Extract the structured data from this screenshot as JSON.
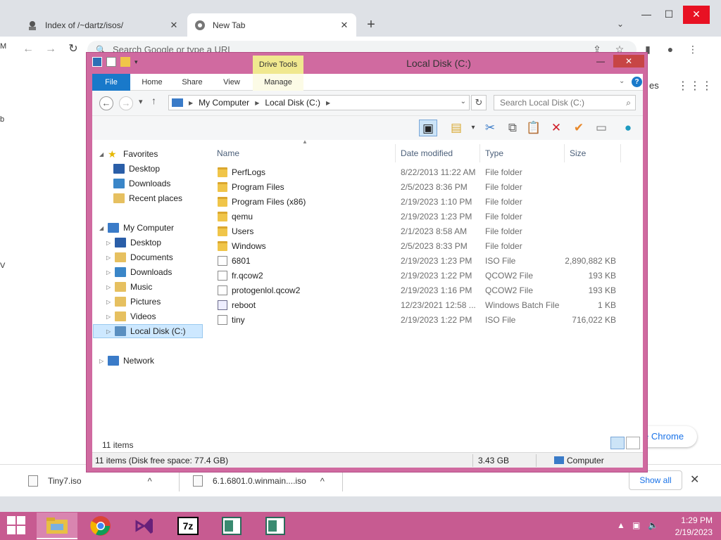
{
  "browser": {
    "tabs": [
      {
        "title": "Index of /~dartz/isos/",
        "close": "✕"
      },
      {
        "title": "New Tab",
        "close": "✕"
      }
    ],
    "new_tab": "+",
    "tab_search": "⌄",
    "window_controls": {
      "min": "—",
      "max": "☐",
      "close": "✕"
    },
    "omnibox_placeholder": "Search Google or type a URL",
    "page_fragment_right": "es",
    "chrome_button": "e Chrome",
    "left_fragments": [
      "M",
      "b",
      "V"
    ]
  },
  "downloads": {
    "items": [
      {
        "name": "Tiny7.iso"
      },
      {
        "name": "6.1.6801.0.winmain....iso"
      }
    ],
    "show_all": "Show all",
    "close": "✕"
  },
  "explorer": {
    "title": "Local Disk (C:)",
    "contextual_tab": "Drive Tools",
    "ribbon_tabs": [
      "File",
      "Home",
      "Share",
      "View",
      "Manage"
    ],
    "address_path": [
      "My Computer",
      "Local Disk (C:)"
    ],
    "search_placeholder": "Search Local Disk (C:)",
    "nav": {
      "favorites": "Favorites",
      "favorites_items": [
        "Desktop",
        "Downloads",
        "Recent places"
      ],
      "computer": "My Computer",
      "computer_items": [
        "Desktop",
        "Documents",
        "Downloads",
        "Music",
        "Pictures",
        "Videos",
        "Local Disk (C:)"
      ],
      "network": "Network"
    },
    "columns": [
      "Name",
      "Date modified",
      "Type",
      "Size"
    ],
    "files": [
      {
        "name": "PerfLogs",
        "date": "8/22/2013 11:22 AM",
        "type": "File folder",
        "size": "",
        "icon": "folder"
      },
      {
        "name": "Program Files",
        "date": "2/5/2023 8:36 PM",
        "type": "File folder",
        "size": "",
        "icon": "folder"
      },
      {
        "name": "Program Files (x86)",
        "date": "2/19/2023 1:10 PM",
        "type": "File folder",
        "size": "",
        "icon": "folder"
      },
      {
        "name": "qemu",
        "date": "2/19/2023 1:23 PM",
        "type": "File folder",
        "size": "",
        "icon": "folder"
      },
      {
        "name": "Users",
        "date": "2/1/2023 8:58 AM",
        "type": "File folder",
        "size": "",
        "icon": "folder"
      },
      {
        "name": "Windows",
        "date": "2/5/2023 8:33 PM",
        "type": "File folder",
        "size": "",
        "icon": "folder"
      },
      {
        "name": "6801",
        "date": "2/19/2023 1:23 PM",
        "type": "ISO File",
        "size": "2,890,882 KB",
        "icon": "file"
      },
      {
        "name": "fr.qcow2",
        "date": "2/19/2023 1:22 PM",
        "type": "QCOW2 File",
        "size": "193 KB",
        "icon": "file"
      },
      {
        "name": "protogenlol.qcow2",
        "date": "2/19/2023 1:16 PM",
        "type": "QCOW2 File",
        "size": "193 KB",
        "icon": "file"
      },
      {
        "name": "reboot",
        "date": "12/23/2021 12:58 ...",
        "type": "Windows Batch File",
        "size": "1 KB",
        "icon": "bat"
      },
      {
        "name": "tiny",
        "date": "2/19/2023 1:22 PM",
        "type": "ISO File",
        "size": "716,022 KB",
        "icon": "file"
      }
    ],
    "item_count": "11 items",
    "status": {
      "left": "11 items (Disk free space: 77.4 GB)",
      "middle": "3.43 GB",
      "right": "Computer"
    }
  },
  "taskbar": {
    "time": "1:29 PM",
    "date": "2/19/2023",
    "apps": [
      "file-explorer",
      "chrome",
      "visual-studio",
      "7zip",
      "explorer-window-1",
      "explorer-window-2"
    ],
    "app_7z_label": "7z"
  },
  "colors": {
    "window_frame": "#d06aa0",
    "taskbar": "#c75b91",
    "ribbon_file": "#1979ca",
    "drive_tools": "#f0e88f"
  }
}
